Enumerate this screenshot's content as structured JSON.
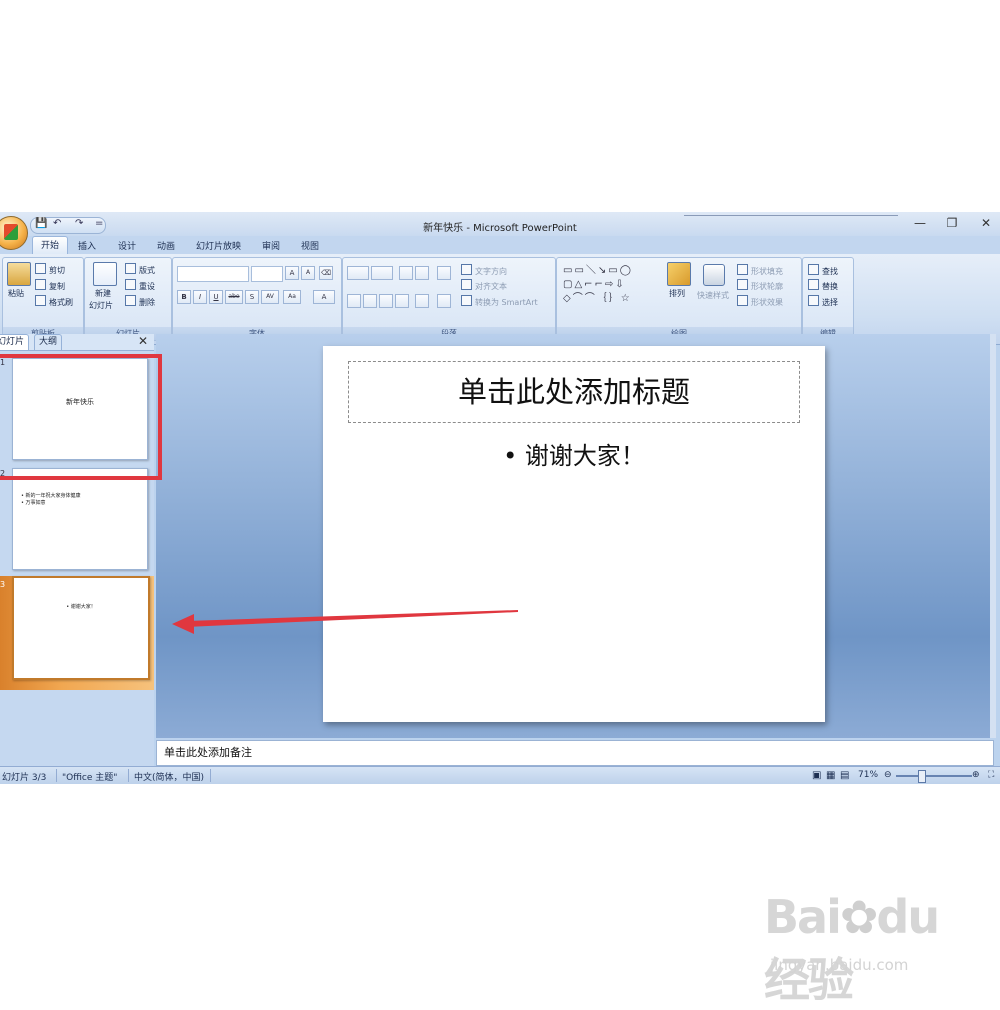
{
  "window": {
    "title": "新年快乐 - Microsoft PowerPoint",
    "minimize": "—",
    "restore": "❐",
    "close": "✕"
  },
  "qat": {
    "save": "💾",
    "undo": "↶",
    "redo": "↷",
    "more": "="
  },
  "tabs": [
    "开始",
    "插入",
    "设计",
    "动画",
    "幻灯片放映",
    "审阅",
    "视图"
  ],
  "ribbon": {
    "clipboard": {
      "label": "剪贴板",
      "paste": "粘贴",
      "cut": "剪切",
      "copy": "复制",
      "format_painter": "格式刷"
    },
    "slides": {
      "label": "幻灯片",
      "new_slide_1": "新建",
      "new_slide_2": "幻灯片",
      "layout": "版式",
      "reset": "重设",
      "delete": "删除"
    },
    "font": {
      "label": "字体",
      "grow": "A",
      "shrink": "A",
      "clear": "⌫",
      "bold": "B",
      "italic": "I",
      "underline": "U",
      "strike": "abe",
      "shadow": "S",
      "spacing": "AV",
      "case": "Aa",
      "color": "A"
    },
    "paragraph": {
      "label": "段落",
      "text_direction": "文字方向",
      "align_text": "对齐文本",
      "smartart": "转换为 SmartArt"
    },
    "drawing": {
      "label": "绘图",
      "arrange": "排列",
      "quick_styles": "快速样式",
      "shape_fill": "形状填充",
      "shape_outline": "形状轮廓",
      "shape_effects": "形状效果"
    },
    "editing": {
      "label": "编辑",
      "find": "查找",
      "replace": "替换",
      "select": "选择"
    }
  },
  "pane": {
    "tab_slides": "幻灯片",
    "tab_outline": "大纲",
    "close": "✕",
    "thumbnails": [
      {
        "num": "1",
        "title": "新年快乐"
      },
      {
        "num": "2",
        "bullets": [
          "新的一年祝大家身体健康",
          "万事如意"
        ]
      },
      {
        "num": "3",
        "bullets": [
          "谢谢大家！"
        ]
      }
    ]
  },
  "slide": {
    "title_placeholder": "单击此处添加标题",
    "body_text": "• 谢谢大家！"
  },
  "notes_placeholder": "单击此处添加备注",
  "status": {
    "slide_count": "幻灯片 3/3",
    "theme": "\"Office 主题\"",
    "language": "中文(简体，中国)",
    "zoom": "71%"
  },
  "watermark": {
    "logo": "Bai du 经验",
    "url": "jingyan.baidu.com"
  },
  "annotation_color": "#e0373f"
}
